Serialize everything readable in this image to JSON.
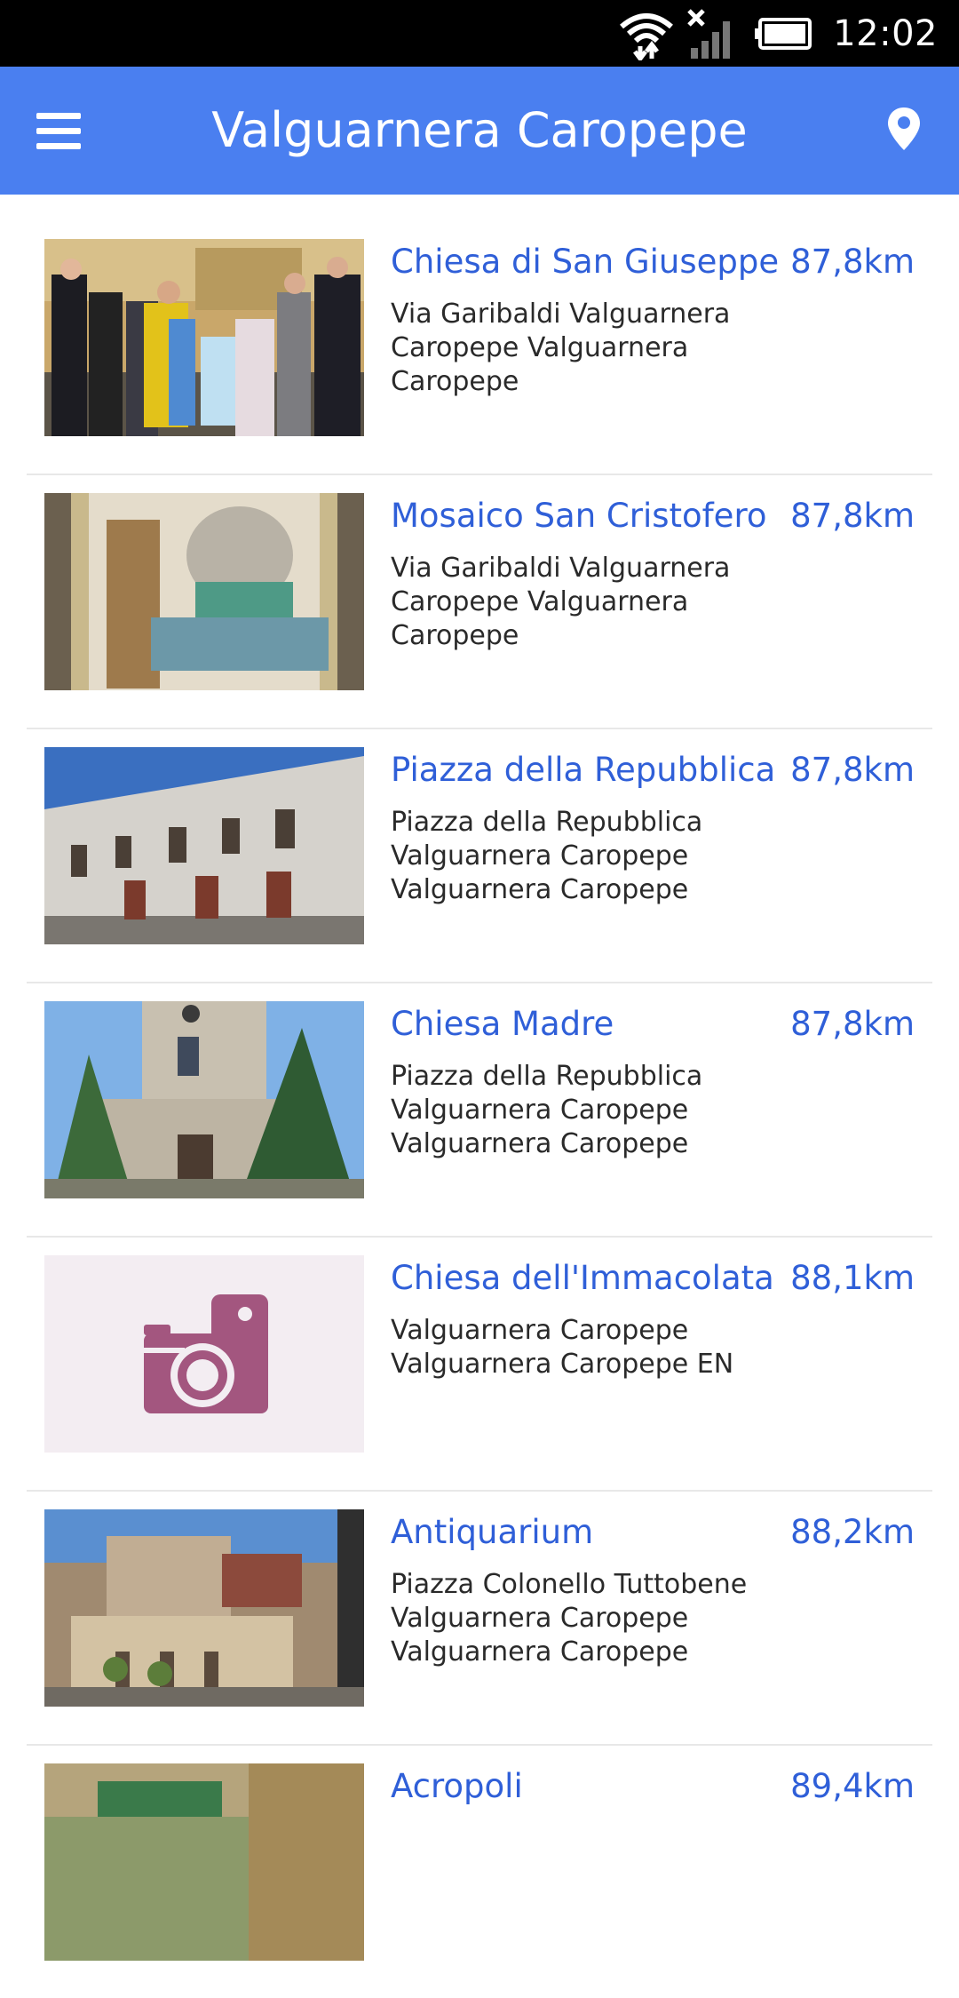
{
  "status_bar": {
    "time": "12:02",
    "icons": [
      "wifi-icon",
      "signal-icon",
      "battery-icon"
    ]
  },
  "app_bar": {
    "title": "Valguarnera Caropepe",
    "menu_icon": "menu-icon",
    "action_icon": "map-pin-icon"
  },
  "colors": {
    "app_bar": "#4a7ff0",
    "accent_text": "#2f5fd8",
    "placeholder_bg": "#f3edf2",
    "placeholder_icon": "#a3567f"
  },
  "pois": [
    {
      "name": "Chiesa di San Giuseppe",
      "distance": "87,8km",
      "address": "Via Garibaldi Valguarnera Caropepe Valguarnera Caropepe",
      "image": "photo"
    },
    {
      "name": "Mosaico San Cristofero",
      "distance": "87,8km",
      "address": "Via Garibaldi Valguarnera Caropepe Valguarnera Caropepe",
      "image": "photo"
    },
    {
      "name": "Piazza della Repubblica",
      "distance": "87,8km",
      "address": "Piazza della Repubblica Valguarnera Caropepe Valguarnera Caropepe",
      "image": "photo"
    },
    {
      "name": "Chiesa Madre",
      "distance": "87,8km",
      "address": "Piazza della Repubblica Valguarnera Caropepe Valguarnera Caropepe",
      "image": "photo"
    },
    {
      "name": "Chiesa dell'Immacolata",
      "distance": "88,1km",
      "address": "Valguarnera Caropepe Valguarnera Caropepe EN",
      "image": "camera-placeholder-icon"
    },
    {
      "name": "Antiquarium",
      "distance": "88,2km",
      "address": "Piazza Colonello Tuttobene Valguarnera Caropepe Valguarnera Caropepe",
      "image": "photo"
    },
    {
      "name": "Acropoli",
      "distance": "89,4km",
      "address": "",
      "image": "photo"
    }
  ]
}
